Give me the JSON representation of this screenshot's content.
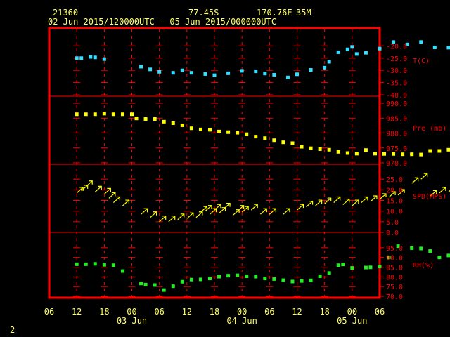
{
  "header": {
    "station": "21360",
    "lat": "77.45S",
    "lon": "170.76E",
    "elev": "35M",
    "period": "02 Jun 2015/120000UTC - 05 Jun 2015/000000UTC"
  },
  "footer": {
    "page": "2"
  },
  "colors": {
    "frame": "#ff0000",
    "text": "#ffff66",
    "tc": "#33e0ff",
    "pres": "#ffff00",
    "wind": "#ffff00",
    "rh": "#22ee22"
  },
  "chart_data": {
    "type": "scatter",
    "x_axis": {
      "ticks": [
        "06",
        "12",
        "18",
        "00",
        "06",
        "12",
        "18",
        "00",
        "06",
        "12",
        "18",
        "00",
        "06"
      ],
      "day_labels": [
        "03 Jun",
        "04 Jun",
        "05 Jun"
      ],
      "range_hours": [
        -6,
        66
      ]
    },
    "panels": [
      {
        "name": "T(C)",
        "ylim": [
          -40,
          -15
        ],
        "ticks": [
          "-20.0",
          "-25.0",
          "-30.0",
          "-35.0",
          "-40.0"
        ],
        "tick_values": [
          -20,
          -25,
          -30,
          -35,
          -40
        ],
        "x": [
          0,
          1,
          3,
          4,
          6,
          14,
          16,
          18,
          21,
          23,
          25,
          28,
          30,
          33,
          36,
          39,
          41,
          43,
          46,
          48,
          51,
          54,
          55,
          57,
          59,
          60,
          61,
          63,
          66,
          69,
          72,
          75,
          78,
          81,
          84,
          87
        ],
        "y": [
          -25.0,
          -25.0,
          -24.5,
          -24.7,
          -25.4,
          -28.5,
          -29.6,
          -30.6,
          -31.0,
          -30.0,
          -31.0,
          -31.5,
          -32.0,
          -31.2,
          -30.2,
          -30.4,
          -31.3,
          -31.8,
          -32.9,
          -31.6,
          -29.8,
          -28.9,
          -26.5,
          -22.6,
          -21.4,
          -20.4,
          -23.3,
          -22.8,
          -21.1,
          -18.4,
          -19.4,
          -18.4,
          -20.6,
          -20.7,
          -20.8,
          -20.9
        ]
      },
      {
        "name": "Pre (mb)",
        "ylim": [
          970,
          990
        ],
        "ticks": [
          "990.0",
          "985.0",
          "980.0",
          "975.0",
          "970.0"
        ],
        "tick_values": [
          990,
          985,
          980,
          975,
          970
        ],
        "x": [
          0,
          2,
          4,
          6,
          8,
          10,
          12,
          13,
          15,
          17,
          19,
          21,
          23,
          25,
          27,
          29,
          31,
          33,
          35,
          37,
          39,
          41,
          43,
          45,
          47,
          49,
          51,
          53,
          55,
          57,
          59,
          61,
          63,
          65,
          67,
          69,
          71,
          73,
          75,
          77,
          79,
          81,
          83,
          85,
          87
        ],
        "y": [
          986.3,
          986.3,
          986.3,
          986.5,
          986.3,
          986.3,
          986.3,
          984.9,
          984.7,
          984.7,
          983.8,
          983.3,
          982.6,
          981.6,
          981.2,
          981.1,
          980.5,
          980.3,
          980.1,
          979.6,
          978.8,
          978.3,
          977.6,
          976.9,
          976.6,
          975.4,
          974.9,
          974.6,
          974.4,
          973.7,
          973.3,
          973.1,
          974.3,
          973.1,
          973.0,
          973.0,
          972.9,
          972.9,
          972.8,
          974.0,
          974.0,
          974.4,
          974.8,
          975.0,
          975.2
        ]
      },
      {
        "name": "SPD(MPS)",
        "ylim": [
          0,
          30
        ],
        "ticks": [
          "25.0",
          "20.0",
          "15.0",
          "10.0",
          "5.0",
          "0.0"
        ],
        "tick_values": [
          25,
          20,
          15,
          10,
          5,
          0
        ],
        "note": "wind vectors: arrow base at (hour, speed); barbs drawn by script",
        "x": [
          0,
          1,
          2,
          4,
          6,
          7,
          8,
          10,
          14,
          16,
          18,
          20,
          22,
          24,
          26,
          27,
          28,
          29,
          30,
          31,
          32,
          34,
          35,
          36,
          38,
          40,
          42,
          45,
          48,
          50,
          52,
          54,
          56,
          58,
          60,
          62,
          64,
          66,
          68,
          70,
          73,
          75,
          77,
          79,
          81,
          83,
          85,
          87
        ],
        "y": [
          18.5,
          19.5,
          21.5,
          19.0,
          18.0,
          16.0,
          14.0,
          12.5,
          8.5,
          7.0,
          5.0,
          5.0,
          6.0,
          6.5,
          7.0,
          9.5,
          10.0,
          8.5,
          10.5,
          9.0,
          11.0,
          8.0,
          10.0,
          9.5,
          10.5,
          8.5,
          8.5,
          8.5,
          10.5,
          12.0,
          12.5,
          13.5,
          14.0,
          13.0,
          12.5,
          14.0,
          14.5,
          15.5,
          16.5,
          17.5,
          23.0,
          25.0,
          17.0,
          18.5,
          19.0,
          19.5,
          20.0,
          16.5
        ]
      },
      {
        "name": "RH(%)",
        "ylim": [
          70,
          100
        ],
        "ticks": [
          "95.0",
          "90.0",
          "85.0",
          "80.0",
          "75.0",
          "70.0"
        ],
        "tick_values": [
          95,
          90,
          85,
          80,
          75,
          70
        ],
        "x": [
          0,
          2,
          4,
          6,
          8,
          10,
          14,
          15,
          17,
          19,
          21,
          23,
          25,
          27,
          29,
          31,
          33,
          35,
          37,
          39,
          41,
          43,
          45,
          47,
          49,
          51,
          53,
          55,
          57,
          58,
          60,
          63,
          64,
          66,
          68,
          70,
          73,
          75,
          77,
          79,
          81,
          83,
          85,
          87
        ],
        "y": [
          86.5,
          86.5,
          86.7,
          86.2,
          86.0,
          83.0,
          76.6,
          76.0,
          75.8,
          73.2,
          75.2,
          77.5,
          78.6,
          78.7,
          79.2,
          80.1,
          80.6,
          80.8,
          80.3,
          80.1,
          79.2,
          78.9,
          78.3,
          77.6,
          77.9,
          78.2,
          80.3,
          82.0,
          86.0,
          86.4,
          84.6,
          84.8,
          84.9,
          85.3,
          90.0,
          95.8,
          94.8,
          94.6,
          93.3,
          90.0,
          91.0,
          91.0,
          90.3,
          90.3
        ]
      }
    ]
  }
}
